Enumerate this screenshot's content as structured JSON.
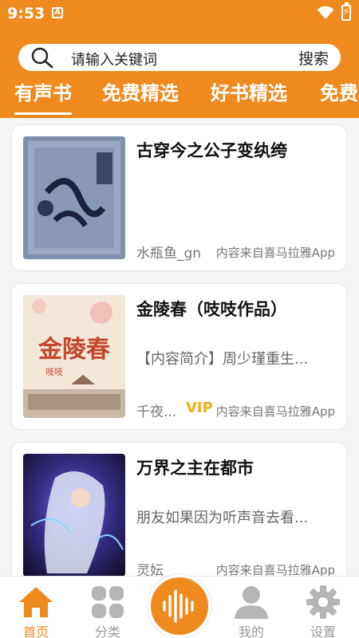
{
  "status": {
    "time": "9:53",
    "badge": "A"
  },
  "search": {
    "placeholder": "请输入关键词",
    "button": "搜索"
  },
  "tabs": [
    {
      "label": "有声书",
      "active": true
    },
    {
      "label": "免费精选",
      "active": false
    },
    {
      "label": "好书精选",
      "active": false
    },
    {
      "label": "免费",
      "active": false
    }
  ],
  "books": [
    {
      "title": "古穿今之公子变纨绔",
      "description": "",
      "author": "水瓶鱼_gn",
      "vip": "",
      "source": "内容来自喜马拉雅App"
    },
    {
      "title": "金陵春（吱吱作品）",
      "description": "【内容简介】周少瑾重生...",
      "author": "千夜...",
      "vip": "VIP",
      "source": "内容来自喜马拉雅App",
      "cover_text": "金陵春",
      "cover_author": "吱吱"
    },
    {
      "title": "万界之主在都市",
      "description": "朋友如果因为听声音去看...",
      "author": "灵妘",
      "vip": "",
      "source": "内容来自喜马拉雅App"
    }
  ],
  "nav": [
    {
      "label": "首页",
      "icon": "home-icon",
      "active": true
    },
    {
      "label": "分类",
      "icon": "grid-icon",
      "active": false
    },
    {
      "label": "",
      "icon": "audio-wave-icon",
      "active": false
    },
    {
      "label": "我的",
      "icon": "user-icon",
      "active": false
    },
    {
      "label": "设置",
      "icon": "gear-icon",
      "active": false
    }
  ],
  "colors": {
    "accent": "#ef8a1e",
    "vip": "#f0ad14",
    "inactive": "#9a9a9a"
  }
}
